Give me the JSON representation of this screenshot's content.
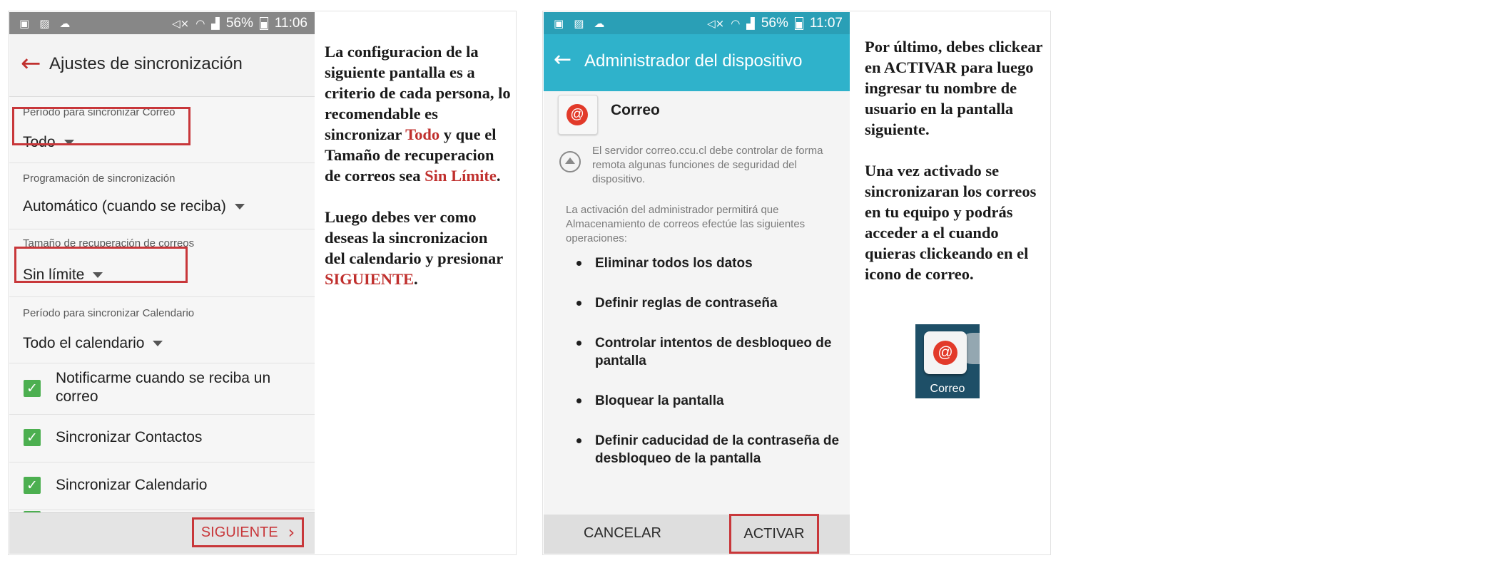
{
  "phone1": {
    "status": {
      "battery": "56%",
      "time": "11:06"
    },
    "title": "Ajustes de sincronización",
    "sections": [
      {
        "label": "Período para sincronizar Correo",
        "value": "Todo"
      },
      {
        "label": "Programación de sincronización",
        "value": "Automático (cuando se reciba)"
      },
      {
        "label": "Tamaño de recuperación de correos",
        "value": "Sin límite"
      },
      {
        "label": "Período para sincronizar Calendario",
        "value": "Todo el calendario"
      }
    ],
    "checks": [
      {
        "label": "Notificarme cuando se reciba un correo",
        "checked": true
      },
      {
        "label": "Sincronizar Contactos",
        "checked": true
      },
      {
        "label": "Sincronizar Calendario",
        "checked": true
      }
    ],
    "next_button": "SIGUIENTE"
  },
  "text1": {
    "p1_a": "La configuracion de la siguiente pantalla es a criterio de cada persona, lo recomendable es sincronizar ",
    "p1_b": "Todo",
    "p1_c": " y que el Tamaño de recuperacion de correos sea ",
    "p1_d": "Sin Límite",
    "p1_e": ".",
    "p2_a": "Luego debes ver como deseas la sincronizacion del calendario y presionar ",
    "p2_b": "SIGUIENTE",
    "p2_c": "."
  },
  "phone2": {
    "status": {
      "battery": "56%",
      "time": "11:07"
    },
    "title": "Administrador del dispositivo",
    "app_name": "Correo",
    "server_note": "El servidor correo.ccu.cl debe controlar de forma remota algunas funciones de seguridad del dispositivo.",
    "description": "La activación del administrador permitirá que Almacenamiento de correos efectúe las siguientes operaciones:",
    "operations": [
      "Eliminar todos los datos",
      "Definir reglas de contraseña",
      "Controlar intentos de desbloqueo de pantalla",
      "Bloquear la pantalla",
      "Definir caducidad de la contraseña de desbloqueo de la pantalla"
    ],
    "cancel_button": "CANCELAR",
    "activate_button": "ACTIVAR"
  },
  "text2": {
    "p1": "Por último, debes clickear en ACTIVAR para luego ingresar tu nombre de usuario en la pantalla siguiente.",
    "p2": "Una vez activado se sincronizaran los correos en tu equipo y podrás acceder a el cuando quieras clickeando en el icono de correo."
  },
  "launcher": {
    "label": "Correo"
  },
  "colors": {
    "accent_red": "#c8373a",
    "teal_appbar": "#2fb2cb",
    "check_green": "#4caf50",
    "mail_red": "#e23a2a"
  }
}
